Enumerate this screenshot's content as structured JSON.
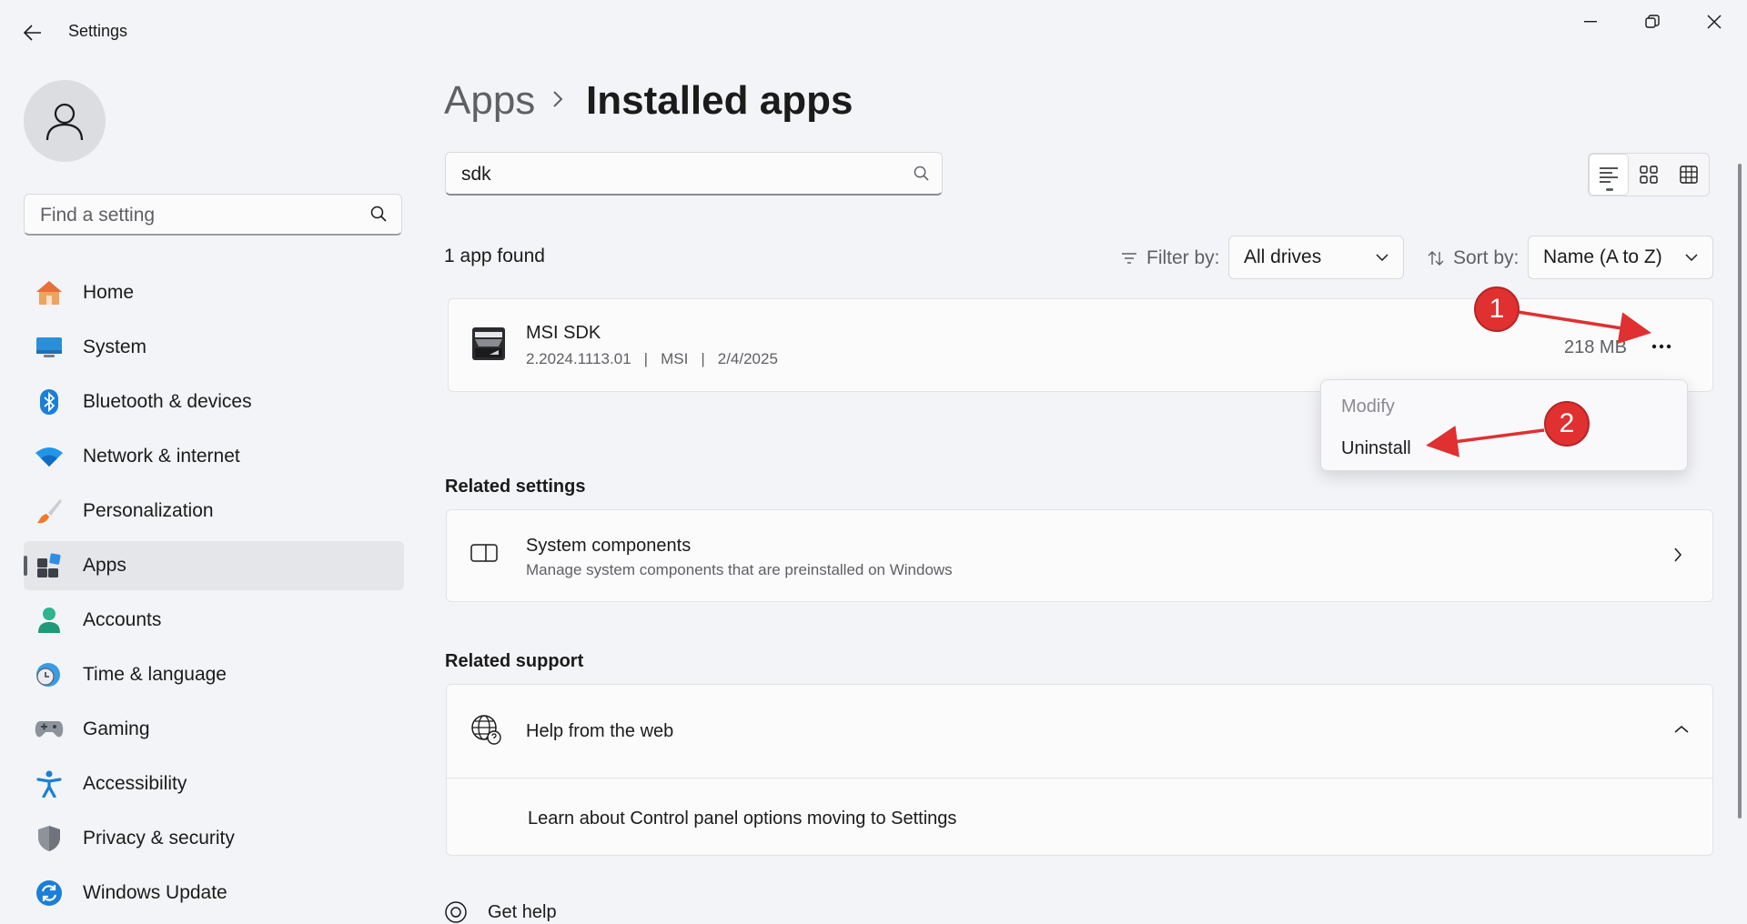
{
  "window": {
    "title": "Settings",
    "controls": [
      "minimize-icon",
      "restore-icon",
      "close-icon"
    ]
  },
  "sidebar": {
    "search_placeholder": "Find a setting",
    "items": [
      {
        "label": "Home",
        "icon": "home-icon"
      },
      {
        "label": "System",
        "icon": "system-icon"
      },
      {
        "label": "Bluetooth & devices",
        "icon": "bluetooth-icon"
      },
      {
        "label": "Network & internet",
        "icon": "wifi-icon"
      },
      {
        "label": "Personalization",
        "icon": "brush-icon"
      },
      {
        "label": "Apps",
        "icon": "apps-icon",
        "active": true
      },
      {
        "label": "Accounts",
        "icon": "accounts-icon"
      },
      {
        "label": "Time & language",
        "icon": "clock-globe-icon"
      },
      {
        "label": "Gaming",
        "icon": "gamepad-icon"
      },
      {
        "label": "Accessibility",
        "icon": "accessibility-icon"
      },
      {
        "label": "Privacy & security",
        "icon": "shield-icon"
      },
      {
        "label": "Windows Update",
        "icon": "update-icon"
      }
    ]
  },
  "breadcrumb": {
    "parent": "Apps",
    "current": "Installed apps"
  },
  "app_search": {
    "value": "sdk"
  },
  "results": {
    "count_text": "1 app found",
    "filter_label": "Filter by:",
    "filter_value": "All drives",
    "sort_label": "Sort by:",
    "sort_value": "Name (A to Z)"
  },
  "apps": [
    {
      "name": "MSI SDK",
      "version": "2.2024.1113.01",
      "publisher": "MSI",
      "date": "2/4/2025",
      "size": "218 MB",
      "separator": "|"
    }
  ],
  "context_menu": {
    "items": [
      {
        "label": "Modify",
        "enabled": false
      },
      {
        "label": "Uninstall",
        "enabled": true
      }
    ]
  },
  "related_settings": {
    "heading": "Related settings",
    "items": [
      {
        "title": "System components",
        "description": "Manage system components that are preinstalled on Windows"
      }
    ]
  },
  "related_support": {
    "heading": "Related support",
    "title": "Help from the web",
    "links": [
      "Learn about Control panel options moving to Settings"
    ]
  },
  "footer": {
    "get_help": "Get help"
  },
  "annotations": [
    {
      "number": "1",
      "color": "#e03030"
    },
    {
      "number": "2",
      "color": "#e03030"
    }
  ]
}
